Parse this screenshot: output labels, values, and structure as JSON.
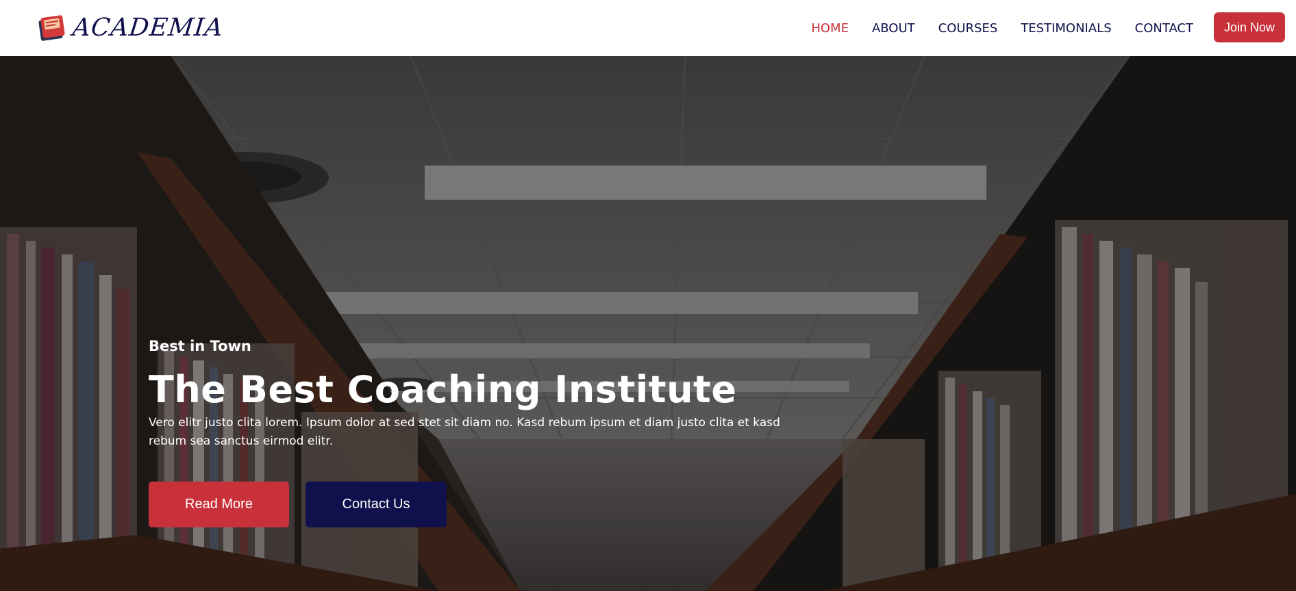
{
  "brand": {
    "name": "ACADEMIA",
    "icon": "book-icon"
  },
  "nav": {
    "items": [
      {
        "label": "HOME",
        "active": true
      },
      {
        "label": "ABOUT",
        "active": false
      },
      {
        "label": "COURSES",
        "active": false
      },
      {
        "label": "TESTIMONIALS",
        "active": false
      },
      {
        "label": "CONTACT",
        "active": false
      }
    ],
    "join_label": "Join Now"
  },
  "hero": {
    "tag": "Best in Town",
    "title": "The Best Coaching Institute",
    "description": "Vero elitr justo clita lorem. Ipsum dolor at sed stet sit diam no. Kasd rebum ipsum et diam justo clita et kasd rebum sea sanctus eirmod elitr.",
    "buttons": {
      "primary": "Read More",
      "secondary": "Contact Us"
    },
    "background_image": "library-aisle-bookshelves"
  },
  "colors": {
    "accent": "#c8313a",
    "navy": "#10104c",
    "white": "#ffffff"
  }
}
